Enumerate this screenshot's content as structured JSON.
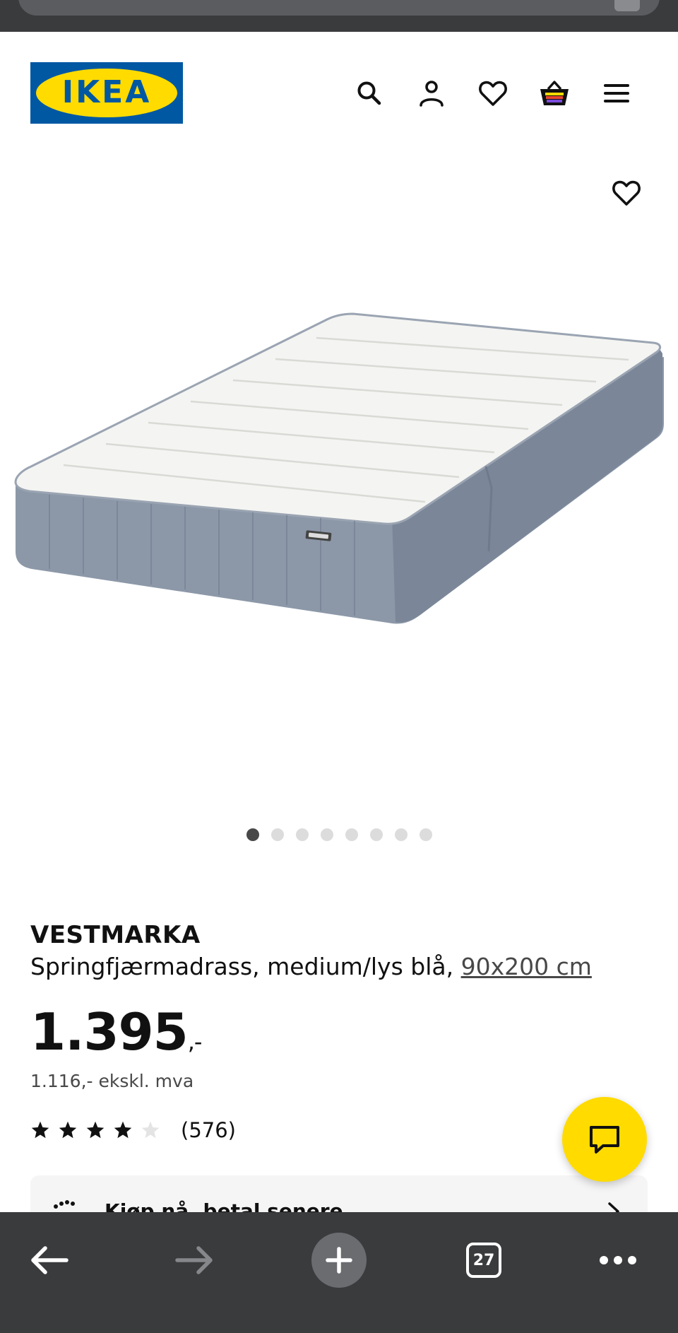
{
  "browser": {
    "tab_count": "27"
  },
  "header": {
    "logo_text": "IKEA",
    "logo_colors": {
      "blue": "#0058a3",
      "yellow": "#ffdb00"
    },
    "icons": [
      "search-icon",
      "account-icon",
      "favourites-icon",
      "cart-icon",
      "menu-icon"
    ]
  },
  "gallery": {
    "image_count": 8,
    "active_index": 0
  },
  "product": {
    "name": "VESTMARKA",
    "description": "Springfjærmadrass, medium/lys blå, ",
    "size": "90x200 cm",
    "price_main": "1.395",
    "price_suffix": ",-",
    "price_ex_vat": "1.116,- ekskl. mva",
    "rating_value": 4,
    "rating_max": 5,
    "rating_count": "(576)"
  },
  "klarna": {
    "label": "Kjøp nå, betal senere"
  },
  "colors": {
    "accent_yellow": "#ffdb00",
    "browser_chrome": "#3a3b3d"
  }
}
